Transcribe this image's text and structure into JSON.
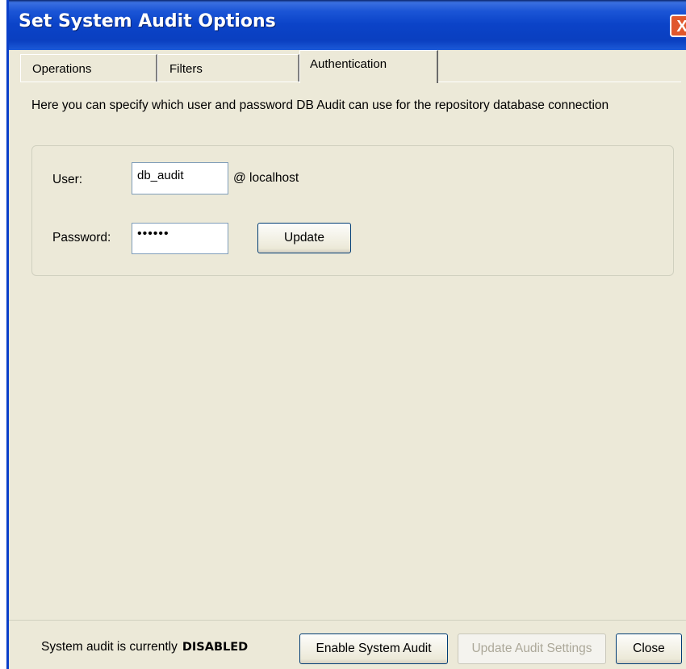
{
  "window": {
    "title": "Set System Audit Options",
    "close_glyph": "X"
  },
  "tabs": [
    {
      "label": "Operations",
      "active": false
    },
    {
      "label": "Filters",
      "active": false
    },
    {
      "label": "Authentication",
      "active": true
    }
  ],
  "auth": {
    "description": "Here you can specify which user and password DB Audit can use for the repository database connection",
    "user_label": "User:",
    "user_value": "db_audit",
    "host_suffix": "@ localhost",
    "password_label": "Password:",
    "password_value": "••••••",
    "update_label": "Update"
  },
  "footer": {
    "status_prefix": "System audit is currently",
    "status_value": "DISABLED",
    "enable_label": "Enable System Audit",
    "update_settings_label": "Update Audit Settings",
    "update_settings_enabled": false,
    "close_label": "Close"
  },
  "colors": {
    "titlebar": "#0b43c8",
    "face": "#ece9d8",
    "close_button": "#e0572c"
  }
}
